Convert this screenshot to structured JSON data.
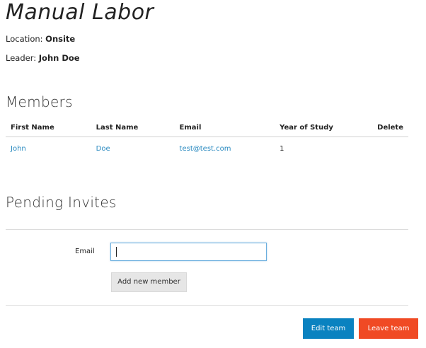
{
  "team": {
    "name": "Manual Labor",
    "location_label": "Location:",
    "location_value": "Onsite",
    "leader_label": "Leader:",
    "leader_value": "John Doe"
  },
  "members": {
    "heading": "Members",
    "columns": [
      "First Name",
      "Last Name",
      "Email",
      "Year of Study",
      "Delete"
    ],
    "rows": [
      {
        "first_name": "John",
        "last_name": "Doe",
        "email": "test@test.com",
        "year": "1",
        "delete": ""
      }
    ]
  },
  "pending": {
    "heading": "Pending Invites",
    "email_label": "Email",
    "email_value": "",
    "email_placeholder": "",
    "add_button": "Add new member"
  },
  "actions": {
    "edit_button": "Edit team",
    "leave_button": "Leave team"
  },
  "colors": {
    "link": "#2a8ac0",
    "edit": "#0a82c0",
    "leave": "#f04a24"
  }
}
